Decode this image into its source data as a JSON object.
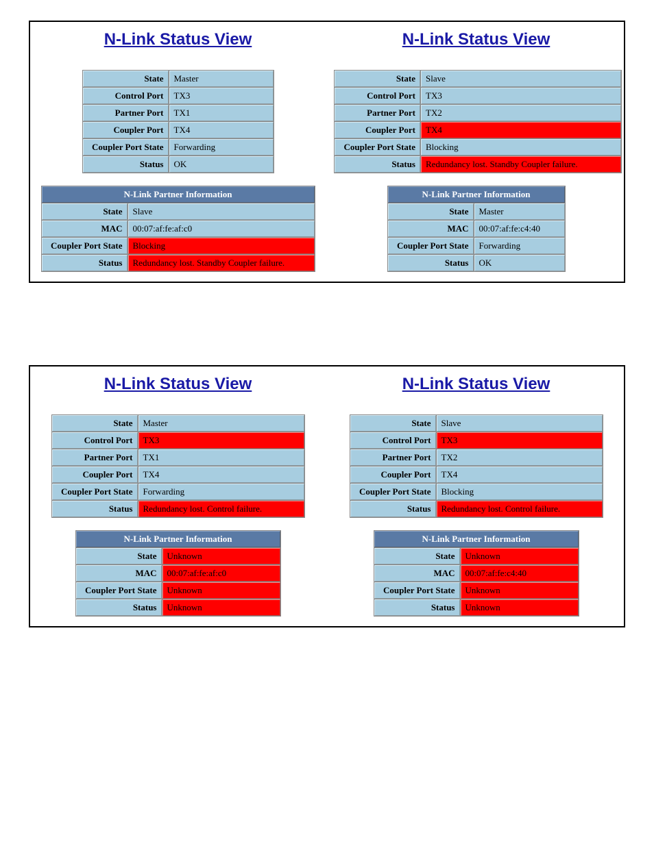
{
  "labels": {
    "title": "N-Link Status View",
    "state": "State",
    "control_port": "Control Port",
    "partner_port": "Partner Port",
    "coupler_port": "Coupler Port",
    "coupler_port_state": "Coupler Port State",
    "status": "Status",
    "partner_header": "N-Link Partner Information",
    "mac": "MAC"
  },
  "groups": [
    {
      "panels": [
        {
          "status_width": 280,
          "partner_width": 400,
          "status": {
            "State": {
              "v": "Master",
              "red": false
            },
            "Control Port": {
              "v": "TX3",
              "red": false
            },
            "Partner Port": {
              "v": "TX1",
              "red": false
            },
            "Coupler Port": {
              "v": "TX4",
              "red": false
            },
            "Coupler Port State": {
              "v": "Forwarding",
              "red": false
            },
            "Status": {
              "v": "OK",
              "red": false
            }
          },
          "partner": {
            "State": {
              "v": "Slave",
              "red": false
            },
            "MAC": {
              "v": "00:07:af:fe:af:c0",
              "red": false
            },
            "Coupler Port State": {
              "v": "Blocking",
              "red": true
            },
            "Status": {
              "v": "Redundancy lost. Standby Coupler failure.",
              "red": true
            }
          }
        },
        {
          "status_width": 420,
          "partner_width": 260,
          "status": {
            "State": {
              "v": "Slave",
              "red": false
            },
            "Control Port": {
              "v": "TX3",
              "red": false
            },
            "Partner Port": {
              "v": "TX2",
              "red": false
            },
            "Coupler Port": {
              "v": "TX4",
              "red": true
            },
            "Coupler Port State": {
              "v": "Blocking",
              "red": false
            },
            "Status": {
              "v": "Redundancy lost. Standby Coupler failure.",
              "red": true
            }
          },
          "partner": {
            "State": {
              "v": "Master",
              "red": false
            },
            "MAC": {
              "v": "00:07:af:fe:c4:40",
              "red": false
            },
            "Coupler Port State": {
              "v": "Forwarding",
              "red": false
            },
            "Status": {
              "v": "OK",
              "red": false
            }
          }
        }
      ]
    },
    {
      "panels": [
        {
          "status_width": 370,
          "partner_width": 300,
          "status": {
            "State": {
              "v": "Master",
              "red": false
            },
            "Control Port": {
              "v": "TX3",
              "red": true
            },
            "Partner Port": {
              "v": "TX1",
              "red": false
            },
            "Coupler Port": {
              "v": "TX4",
              "red": false
            },
            "Coupler Port State": {
              "v": "Forwarding",
              "red": false
            },
            "Status": {
              "v": "Redundancy lost. Control failure.",
              "red": true
            }
          },
          "partner": {
            "State": {
              "v": "Unknown",
              "red": true
            },
            "MAC": {
              "v": "00:07:af:fe:af:c0",
              "red": true
            },
            "Coupler Port State": {
              "v": "Unknown",
              "red": true
            },
            "Status": {
              "v": "Unknown",
              "red": true
            }
          }
        },
        {
          "status_width": 370,
          "partner_width": 300,
          "status": {
            "State": {
              "v": "Slave",
              "red": false
            },
            "Control Port": {
              "v": "TX3",
              "red": true
            },
            "Partner Port": {
              "v": "TX2",
              "red": false
            },
            "Coupler Port": {
              "v": "TX4",
              "red": false
            },
            "Coupler Port State": {
              "v": "Blocking",
              "red": false
            },
            "Status": {
              "v": "Redundancy lost. Control failure.",
              "red": true
            }
          },
          "partner": {
            "State": {
              "v": "Unknown",
              "red": true
            },
            "MAC": {
              "v": "00:07:af:fe:c4:40",
              "red": true
            },
            "Coupler Port State": {
              "v": "Unknown",
              "red": true
            },
            "Status": {
              "v": "Unknown",
              "red": true
            }
          }
        }
      ]
    }
  ]
}
